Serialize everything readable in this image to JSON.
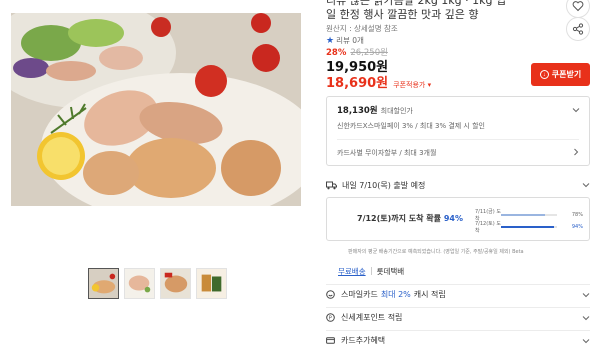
{
  "product": {
    "title_line1": "리뷰 많은 닭가슴살 2kg 1kg · 1kg 입",
    "title_line2": "일 한정 행사 깔끔한 맛과 깊은 향",
    "origin": "원산지 : 상세설명 참조",
    "rating_star": "★",
    "review_label": "리뷰 0개",
    "discount_rate": "28%",
    "original_price": "26,250원",
    "sale_price": "19,950원",
    "coupon_price": "18,690원",
    "coupon_price_label": "쿠폰적용가 ▾",
    "coupon_button": "쿠폰받기"
  },
  "card_benefits": {
    "best_price": "18,130원",
    "best_label": "최대할인가",
    "line1": "신한카드X스마일페이 3% / 최대 3% 결제 시 할인",
    "line2": "카드사별 무이자할부 / 최대 3개월"
  },
  "delivery": {
    "header": "내일 7/10(목) 출발 예정",
    "arrival_main": "7/12(토)까지 도착 확률",
    "arrival_pct": "94%",
    "bars": [
      {
        "label": "7/11(금) 도착",
        "value": 78,
        "value_label": "78%",
        "emphasis": false
      },
      {
        "label": "7/12(토) 도착",
        "value": 94,
        "value_label": "94%",
        "emphasis": true
      }
    ],
    "note": "판매자의 평균 배송기간으로 예측되었습니다. (영업일 기준, 주말/공휴일 제외) Beta"
  },
  "shipping_links": {
    "free": "무료배송",
    "carrier": "롯데택배"
  },
  "options": [
    {
      "label": "스마일카드",
      "accent": "최대 2%",
      "suffix": "캐시 적립",
      "icon": "smile-card-icon"
    },
    {
      "label": "신세계포인트 적립",
      "accent": "",
      "suffix": "",
      "icon": "point-icon"
    },
    {
      "label": "카드추가혜택",
      "accent": "",
      "suffix": "",
      "icon": "card-icon"
    }
  ],
  "colors": {
    "accent_red": "#e8311a",
    "accent_blue": "#2a60c9"
  }
}
